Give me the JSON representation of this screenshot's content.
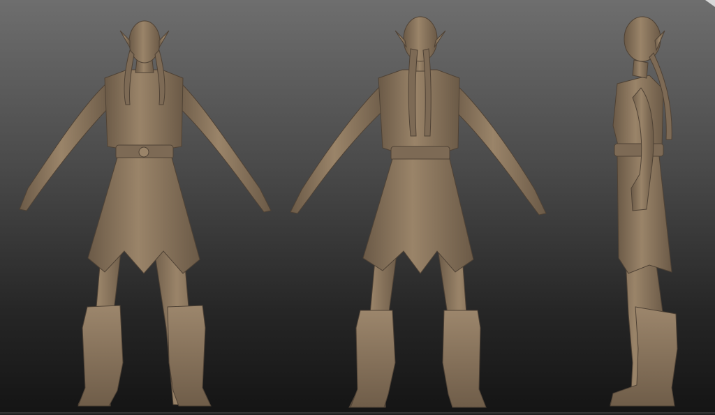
{
  "scene": {
    "background_top": "#6e6e6e",
    "background_bottom": "#141414",
    "clay_color": "#8a7660",
    "clay_shadow": "#5e4f3f",
    "clay_highlight": "#a69078"
  },
  "views": [
    {
      "name": "front"
    },
    {
      "name": "back"
    },
    {
      "name": "side"
    }
  ]
}
